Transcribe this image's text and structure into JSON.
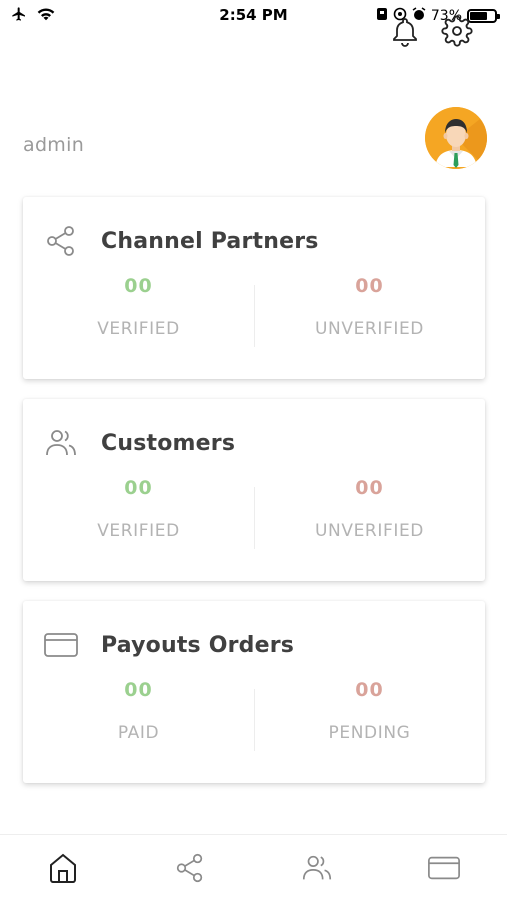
{
  "status_bar": {
    "time": "2:54 PM",
    "battery": "73%"
  },
  "user": {
    "name": "admin"
  },
  "cards": [
    {
      "title": "Channel Partners",
      "icon": "share-icon",
      "left": {
        "value": "00",
        "label": "VERIFIED",
        "color": "#9bd08f"
      },
      "right": {
        "value": "00",
        "label": "UNVERIFIED",
        "color": "#d9a39a"
      }
    },
    {
      "title": "Customers",
      "icon": "users-icon",
      "left": {
        "value": "00",
        "label": "VERIFIED",
        "color": "#9bd08f"
      },
      "right": {
        "value": "00",
        "label": "UNVERIFIED",
        "color": "#d9a39a"
      }
    },
    {
      "title": "Payouts Orders",
      "icon": "card-icon",
      "left": {
        "value": "00",
        "label": "PAID",
        "color": "#9bd08f"
      },
      "right": {
        "value": "00",
        "label": "PENDING",
        "color": "#d9a39a"
      }
    }
  ],
  "bottom_nav": [
    {
      "icon": "home-icon",
      "active": true
    },
    {
      "icon": "share-icon",
      "active": false
    },
    {
      "icon": "users-icon",
      "active": false
    },
    {
      "icon": "card-icon",
      "active": false
    }
  ]
}
